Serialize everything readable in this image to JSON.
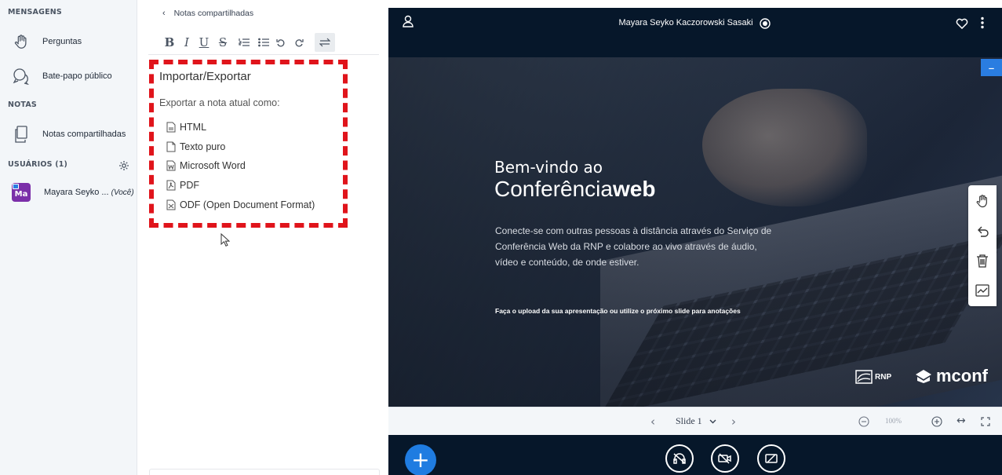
{
  "sidebar": {
    "messages_header": "MENSAGENS",
    "items": [
      {
        "label": "Perguntas",
        "icon": "hand-raise-icon"
      },
      {
        "label": "Bate-papo público",
        "icon": "chat-icon"
      }
    ],
    "notes_header": "NOTAS",
    "notes_item": {
      "label": "Notas compartilhadas",
      "icon": "notes-icon"
    },
    "users_header": "USUÁRIOS (1)",
    "user": {
      "initials": "Ma",
      "name": "Mayara Seyko ...",
      "you": "(Você)"
    }
  },
  "notes": {
    "back_label": "Notas compartilhadas",
    "toolbar": [
      "B",
      "I",
      "U",
      "S",
      "ordered-list",
      "bullet-list",
      "undo",
      "redo",
      "import-export"
    ],
    "import_export": {
      "title": "Importar/Exportar",
      "subtitle": "Exportar a nota atual como:",
      "options": [
        "HTML",
        "Texto puro",
        "Microsoft Word",
        "PDF",
        "ODF (Open Document Format)"
      ]
    }
  },
  "presentation": {
    "meeting_title": "Mayara Seyko Kaczorowski Sasaki",
    "separator": "|",
    "slide": {
      "line1": "Bem-vindo ao",
      "line2_light": "Conferência",
      "line2_bold": "web",
      "body": "Conecte-se com outras pessoas à distância através do Serviço de Conferência Web da RNP e colabore ao vivo através de áudio, vídeo e conteúdo, de onde estiver.",
      "upload_hint": "Faça o upload da sua apresentação ou utilize o próximo slide para anotações",
      "logo_rnp": "RNP",
      "logo_mconf": "mconf"
    },
    "minimize_label": "–",
    "slide_nav": {
      "label": "Slide 1",
      "zoom": "100%"
    }
  },
  "colors": {
    "accent": "#1f7ce1",
    "highlight_border": "#e0141b",
    "dark_bg": "#06172a",
    "avatar": "#7b2fa9"
  }
}
